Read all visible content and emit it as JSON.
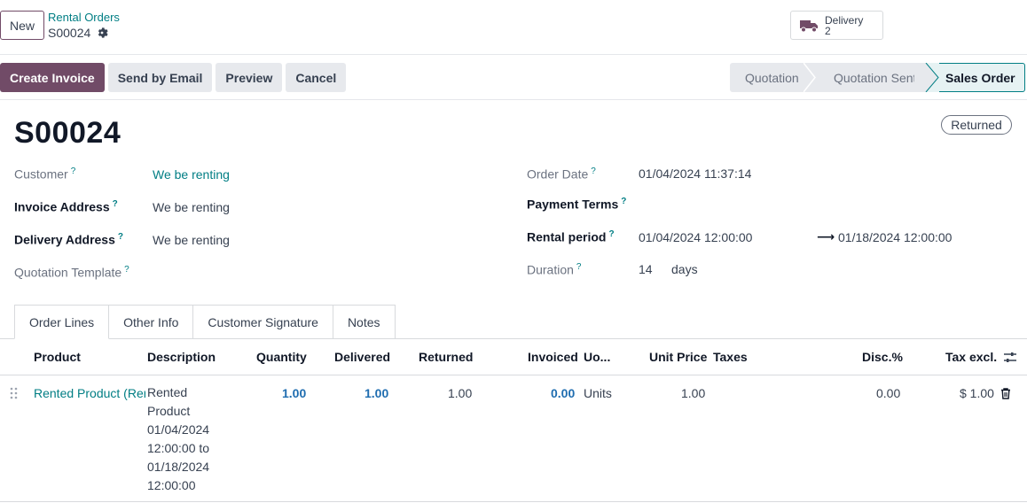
{
  "control": {
    "new_label": "New",
    "breadcrumb_parent": "Rental Orders",
    "breadcrumb_current": "S00024",
    "smart_button": {
      "label": "Delivery",
      "count": "2"
    }
  },
  "actions": {
    "create_invoice": "Create Invoice",
    "send_by_email": "Send by Email",
    "preview": "Preview",
    "cancel": "Cancel"
  },
  "statusbar": {
    "steps": [
      "Quotation",
      "Quotation Sent",
      "Sales Order"
    ],
    "current": "Sales Order"
  },
  "record": {
    "name": "S00024",
    "ribbon": "Returned",
    "fields": {
      "customer": {
        "label": "Customer",
        "value": "We be renting"
      },
      "invoice_address": {
        "label": "Invoice Address",
        "value": "We be renting"
      },
      "delivery_address": {
        "label": "Delivery Address",
        "value": "We be renting"
      },
      "quotation_template": {
        "label": "Quotation Template",
        "value": ""
      },
      "order_date": {
        "label": "Order Date",
        "value": "01/04/2024 11:37:14"
      },
      "payment_terms": {
        "label": "Payment Terms",
        "value": ""
      },
      "rental_period": {
        "label": "Rental period",
        "start": "01/04/2024 12:00:00",
        "arrow": "⟶",
        "end": "01/18/2024 12:00:00"
      },
      "duration": {
        "label": "Duration",
        "value": "14",
        "unit": "days"
      }
    },
    "help_mark": "?"
  },
  "tabs": [
    "Order Lines",
    "Other Info",
    "Customer Signature",
    "Notes"
  ],
  "order_lines": {
    "columns": [
      "Product",
      "Description",
      "Quantity",
      "Delivered",
      "Returned",
      "Invoiced",
      "Uo...",
      "Unit Price",
      "Taxes",
      "Disc.%",
      "Tax excl."
    ],
    "rows": [
      {
        "product": "Rented Product (Rer",
        "description": "Rented Product 01/04/2024 12:00:00 to 01/18/2024 12:00:00",
        "quantity": "1.00",
        "delivered": "1.00",
        "returned": "1.00",
        "invoiced": "0.00",
        "uom": "Units",
        "unit_price": "1.00",
        "taxes": "",
        "discount": "0.00",
        "subtotal": "$ 1.00"
      }
    ]
  },
  "colors": {
    "primary": "#714B67",
    "link": "#017e84",
    "number_link": "#1f6db0"
  }
}
